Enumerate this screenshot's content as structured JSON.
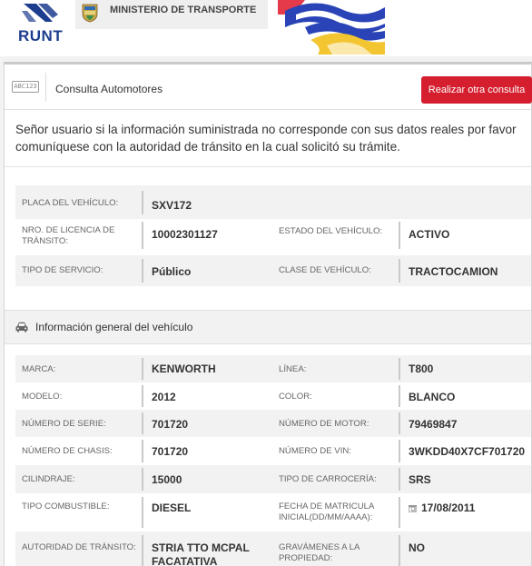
{
  "header": {
    "runt_logo_text": "RUNT",
    "ministry_text": "MINISTERIO DE TRANSPORTE"
  },
  "consulta": {
    "title": "Consulta Automotores",
    "icon_label": "ABC123",
    "button_label": "Realizar otra consulta"
  },
  "notice": "Señor usuario si la información suministrada no corresponde con sus datos reales por favor comuníquese con la autoridad de tránsito en la cual solicitó su trámite.",
  "summary": {
    "placa_label": "PLACA DEL VEHÍCULO:",
    "placa_value": "SXV172",
    "licencia_label": "NRO. DE LICENCIA DE TRÁNSITO:",
    "licencia_value": "10002301127",
    "estado_label": "ESTADO DEL VEHÍCULO:",
    "estado_value": "ACTIVO",
    "servicio_label": "TIPO DE SERVICIO:",
    "servicio_value": "Público",
    "clase_label": "CLASE DE VEHÍCULO:",
    "clase_value": "TRACTOCAMION"
  },
  "general": {
    "section_title": "Información general del vehículo",
    "rows": [
      {
        "l1": "MARCA:",
        "v1": "KENWORTH",
        "l2": "LÍNEA:",
        "v2": "T800"
      },
      {
        "l1": "MODELO:",
        "v1": "2012",
        "l2": "COLOR:",
        "v2": "BLANCO"
      },
      {
        "l1": "NÚMERO DE SERIE:",
        "v1": "701720",
        "l2": "NÚMERO DE MOTOR:",
        "v2": "79469847"
      },
      {
        "l1": "NÚMERO DE CHASIS:",
        "v1": "701720",
        "l2": "NÚMERO DE VIN:",
        "v2": "3WKDD40X7CF701720"
      },
      {
        "l1": "CILINDRAJE:",
        "v1": "15000",
        "l2": "TIPO DE CARROCERÍA:",
        "v2": "SRS"
      },
      {
        "l1": "TIPO COMBUSTIBLE:",
        "v1": "DIESEL",
        "l2": "FECHA DE MATRICULA INICIAL(DD/MM/AAAA):",
        "v2": "17/08/2011"
      },
      {
        "l1": "AUTORIDAD DE TRÁNSITO:",
        "v1": "STRIA TTO MCPAL FACATATIVA",
        "l2": "GRAVÁMENES A LA PROPIEDAD:",
        "v2": "NO"
      }
    ]
  },
  "colors": {
    "accent_red": "#d51f2f",
    "runt_blue": "#1d3d8f",
    "row_alt": "#f2f2f2"
  }
}
